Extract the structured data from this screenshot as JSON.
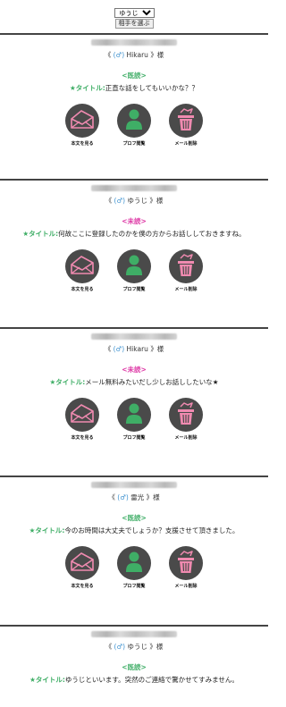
{
  "header": {
    "select_value": "ゆうじ",
    "button_label": "相手を選ぶ"
  },
  "actions": {
    "read_label": "本文を見る",
    "profile_label": "プロフ閲覧",
    "delete_label": "メール削除"
  },
  "colors": {
    "read_status": "#45b06b",
    "unread_status": "#de3aa6",
    "title_label": "#3fae66",
    "male_symbol": "#3e92d0",
    "icon_circle": "#4a4a4a",
    "icon_pink": "#f08ab0",
    "icon_green": "#3fae66"
  },
  "icons": [
    "envelope-icon",
    "person-icon",
    "trash-icon"
  ],
  "messages": [
    {
      "prefix": "《",
      "sex": "(♂)",
      "name": "Hikaru",
      "suffix": "》様",
      "status": "<既読>",
      "title_label": "★タイトル:",
      "title": "正直な話をしてもいいかな？？"
    },
    {
      "prefix": "《",
      "sex": "(♂)",
      "name": "ゆうじ",
      "suffix": "》様",
      "status": "<未読>",
      "title_label": "★タイトル:",
      "title": "何故ここに登録したのかを僕の方からお話ししておきますね。"
    },
    {
      "prefix": "《",
      "sex": "(♂)",
      "name": "Hikaru",
      "suffix": "》様",
      "status": "<未読>",
      "title_label": "★タイトル:",
      "title": "メール無料みたいだし少しお話ししたいな★"
    },
    {
      "prefix": "《",
      "sex": "(♂)",
      "name": "雷光",
      "suffix": "》様",
      "status": "<既読>",
      "title_label": "★タイトル:",
      "title": "今のお時間は大丈夫でしょうか？支援させて頂きました。"
    },
    {
      "prefix": "《",
      "sex": "(♂)",
      "name": "ゆうじ",
      "suffix": "》様",
      "status": "<既読>",
      "title_label": "★タイトル:",
      "title": "ゆうじといいます。突然のご連絡で驚かせてすみません。"
    }
  ]
}
